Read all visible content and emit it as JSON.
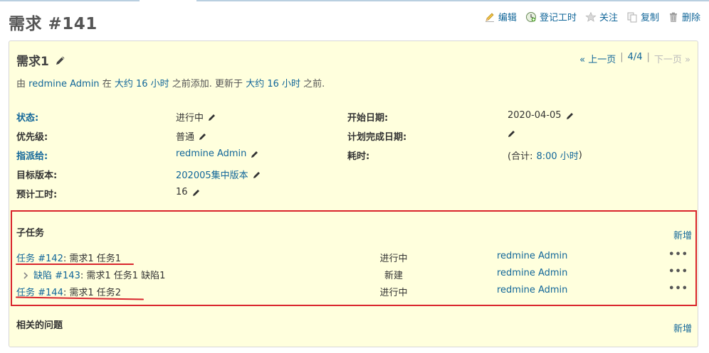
{
  "page": {
    "title": "需求 #141"
  },
  "actions": [
    {
      "label": "编辑",
      "icon": "pencil-icon"
    },
    {
      "label": "登记工时",
      "icon": "clock-icon"
    },
    {
      "label": "关注",
      "icon": "star-icon"
    },
    {
      "label": "复制",
      "icon": "copy-icon"
    },
    {
      "label": "删除",
      "icon": "trash-icon"
    }
  ],
  "issue": {
    "subject": "需求1",
    "nav": {
      "prev": "« 上一页",
      "position": "4/4",
      "next": "下一页 »",
      "sep": "|"
    },
    "author": {
      "prefix": "由",
      "author": "redmine Admin",
      "in": "在",
      "added": "大约 16 小时",
      "added_suffix": "之前添加. 更新于",
      "updated": "大约 16 小时",
      "updated_suffix": "之前."
    },
    "attributes": {
      "status_label": "状态:",
      "status": "进行中",
      "priority_label": "优先级:",
      "priority": "普通",
      "assignee_label": "指派给:",
      "assignee": "redmine Admin",
      "version_label": "目标版本:",
      "version": "202005集中版本",
      "estimated_label": "预计工时:",
      "estimated": "16",
      "start_label": "开始日期:",
      "start": "2020-04-05",
      "due_label": "计划完成日期:",
      "spent_label": "耗时:",
      "spent_prefix": "(合计:",
      "spent": "8:00 小时",
      "spent_suffix": ")"
    },
    "subtasks": {
      "title": "子任务",
      "add": "新增",
      "rows": [
        {
          "tracker_id": "任务 #142",
          "subject": ": 需求1 任务1",
          "status": "进行中",
          "assignee": "redmine Admin",
          "more": "•••"
        },
        {
          "tracker_id": "缺陷 #143",
          "subject": ": 需求1 任务1 缺陷1",
          "status": "新建",
          "assignee": "redmine Admin",
          "more": "•••"
        },
        {
          "tracker_id": "任务 #144",
          "subject": ": 需求1 任务2",
          "status": "进行中",
          "assignee": "redmine Admin",
          "more": "•••"
        }
      ]
    },
    "relations": {
      "title": "相关的问题",
      "add": "新增"
    }
  },
  "colors": {
    "accent": "#169",
    "highlight": "#d9242c",
    "box_bg": "#ffffdd"
  }
}
